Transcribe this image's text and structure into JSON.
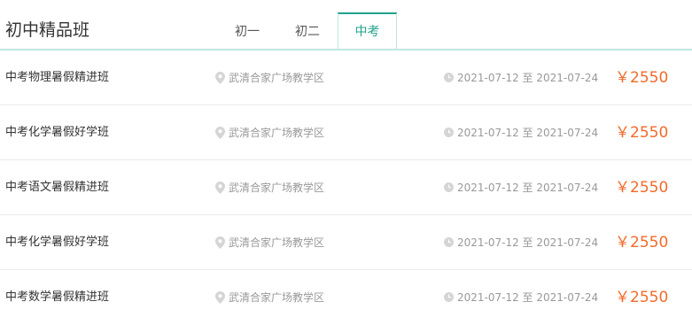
{
  "header": {
    "title": "初中精品班",
    "tabs": [
      {
        "label": "初一"
      },
      {
        "label": "初二"
      },
      {
        "label": "中考"
      }
    ],
    "active_tab": "中考",
    "accent_color": "#20a38c"
  },
  "courses": [
    {
      "name": "中考物理暑假精进班",
      "location": "武清合家广场教学区",
      "dates": "2021-07-12 至 2021-07-24",
      "price": "￥2550"
    },
    {
      "name": "中考化学暑假好学班",
      "location": "武清合家广场教学区",
      "dates": "2021-07-12 至 2021-07-24",
      "price": "￥2550"
    },
    {
      "name": "中考语文暑假精进班",
      "location": "武清合家广场教学区",
      "dates": "2021-07-12 至 2021-07-24",
      "price": "￥2550"
    },
    {
      "name": "中考化学暑假好学班",
      "location": "武清合家广场教学区",
      "dates": "2021-07-12 至 2021-07-24",
      "price": "￥2550"
    },
    {
      "name": "中考数学暑假精进班",
      "location": "武清合家广场教学区",
      "dates": "2021-07-12 至 2021-07-24",
      "price": "￥2550"
    }
  ],
  "icons": {
    "location": "map-pin-icon",
    "date": "clock-icon"
  },
  "price_color": "#f26a2a"
}
